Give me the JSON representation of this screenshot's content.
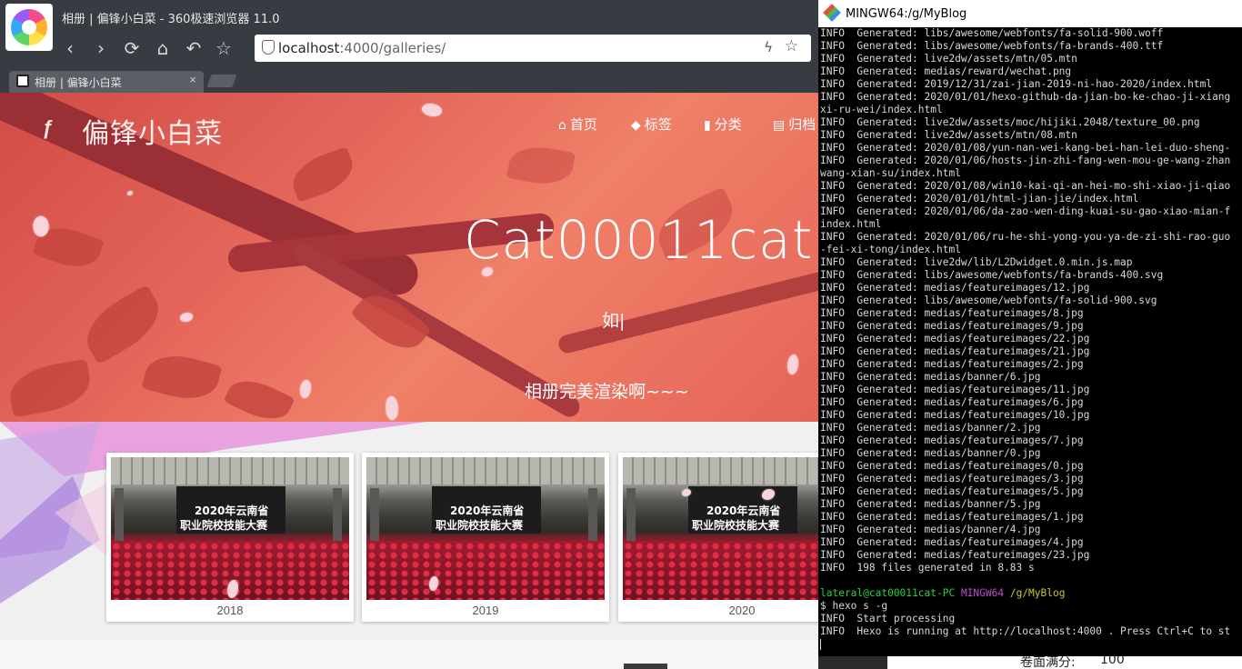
{
  "browser": {
    "window_title": "相册 | 偏锋小白菜 - 360极速浏览器 11.0",
    "address": {
      "host": "localhost",
      "path": ":4000/galleries/"
    },
    "tab": {
      "label": "相册 | 偏锋小白菜",
      "close": "×"
    },
    "nav": {
      "back": "‹",
      "forward": "›",
      "reload": "⟳",
      "home": "⌂",
      "undo": "↶",
      "bookmark": "☆"
    },
    "address_icons": {
      "bolt": "ϟ",
      "star": "☆"
    }
  },
  "site": {
    "logo_icon": "ƒ",
    "title": "偏锋小白菜",
    "menu": [
      {
        "icon": "home-icon",
        "glyph": "⌂",
        "label": "首页"
      },
      {
        "icon": "tag-icon",
        "glyph": "◆",
        "label": "标签"
      },
      {
        "icon": "bookmark-icon",
        "glyph": "▮",
        "label": "分类"
      },
      {
        "icon": "archive-icon",
        "glyph": "▤",
        "label": "归档"
      }
    ],
    "hero": {
      "title": "Cat00011cat",
      "subtitle": "如|",
      "description": "相册完美渲染啊~~~"
    },
    "gallery": {
      "banner_line1": "2020年云南省",
      "banner_line2": "职业院校技能大赛",
      "cards": [
        {
          "year": "2018"
        },
        {
          "year": "2019"
        },
        {
          "year": "2020"
        }
      ]
    }
  },
  "terminal": {
    "title": "MINGW64:/g/MyBlog",
    "lines": [
      "INFO  Generated: libs/awesome/webfonts/fa-solid-900.woff",
      "INFO  Generated: libs/awesome/webfonts/fa-brands-400.ttf",
      "INFO  Generated: live2dw/assets/mtn/05.mtn",
      "INFO  Generated: medias/reward/wechat.png",
      "INFO  Generated: 2019/12/31/zai-jian-2019-ni-hao-2020/index.html",
      "INFO  Generated: 2020/01/01/hexo-github-da-jian-bo-ke-chao-ji-xiang",
      "xi-ru-wei/index.html",
      "INFO  Generated: live2dw/assets/moc/hijiki.2048/texture_00.png",
      "INFO  Generated: live2dw/assets/mtn/08.mtn",
      "INFO  Generated: 2020/01/08/yun-nan-wei-kang-bei-han-lei-duo-sheng-",
      "INFO  Generated: 2020/01/06/hosts-jin-zhi-fang-wen-mou-ge-wang-zhan",
      "wang-xian-su/index.html",
      "INFO  Generated: 2020/01/08/win10-kai-qi-an-hei-mo-shi-xiao-ji-qiao",
      "INFO  Generated: 2020/01/01/html-jian-jie/index.html",
      "INFO  Generated: 2020/01/06/da-zao-wen-ding-kuai-su-gao-xiao-mian-f",
      "index.html",
      "INFO  Generated: 2020/01/06/ru-he-shi-yong-you-ya-de-zi-shi-rao-guo",
      "-fei-xi-tong/index.html",
      "INFO  Generated: live2dw/lib/L2Dwidget.0.min.js.map",
      "INFO  Generated: libs/awesome/webfonts/fa-brands-400.svg",
      "INFO  Generated: medias/featureimages/12.jpg",
      "INFO  Generated: libs/awesome/webfonts/fa-solid-900.svg",
      "INFO  Generated: medias/featureimages/8.jpg",
      "INFO  Generated: medias/featureimages/9.jpg",
      "INFO  Generated: medias/featureimages/22.jpg",
      "INFO  Generated: medias/featureimages/21.jpg",
      "INFO  Generated: medias/featureimages/2.jpg",
      "INFO  Generated: medias/banner/6.jpg",
      "INFO  Generated: medias/featureimages/11.jpg",
      "INFO  Generated: medias/featureimages/6.jpg",
      "INFO  Generated: medias/featureimages/10.jpg",
      "INFO  Generated: medias/banner/2.jpg",
      "INFO  Generated: medias/featureimages/7.jpg",
      "INFO  Generated: medias/banner/0.jpg",
      "INFO  Generated: medias/featureimages/0.jpg",
      "INFO  Generated: medias/featureimages/3.jpg",
      "INFO  Generated: medias/featureimages/5.jpg",
      "INFO  Generated: medias/banner/5.jpg",
      "INFO  Generated: medias/featureimages/1.jpg",
      "INFO  Generated: medias/banner/4.jpg",
      "INFO  Generated: medias/featureimages/4.jpg",
      "INFO  Generated: medias/featureimages/23.jpg",
      "INFO  198 files generated in 8.83 s"
    ],
    "prompt": {
      "user": "lateral@cat00011cat-PC",
      "system": "MINGW64",
      "dir": "/g/MyBlog"
    },
    "command": "$ hexo s -g",
    "after": [
      "INFO  Start processing",
      "INFO  Hexo is running at http://localhost:4000 . Press Ctrl+C to st"
    ]
  },
  "underlay": {
    "label": "卷面满分:",
    "value": "100"
  }
}
